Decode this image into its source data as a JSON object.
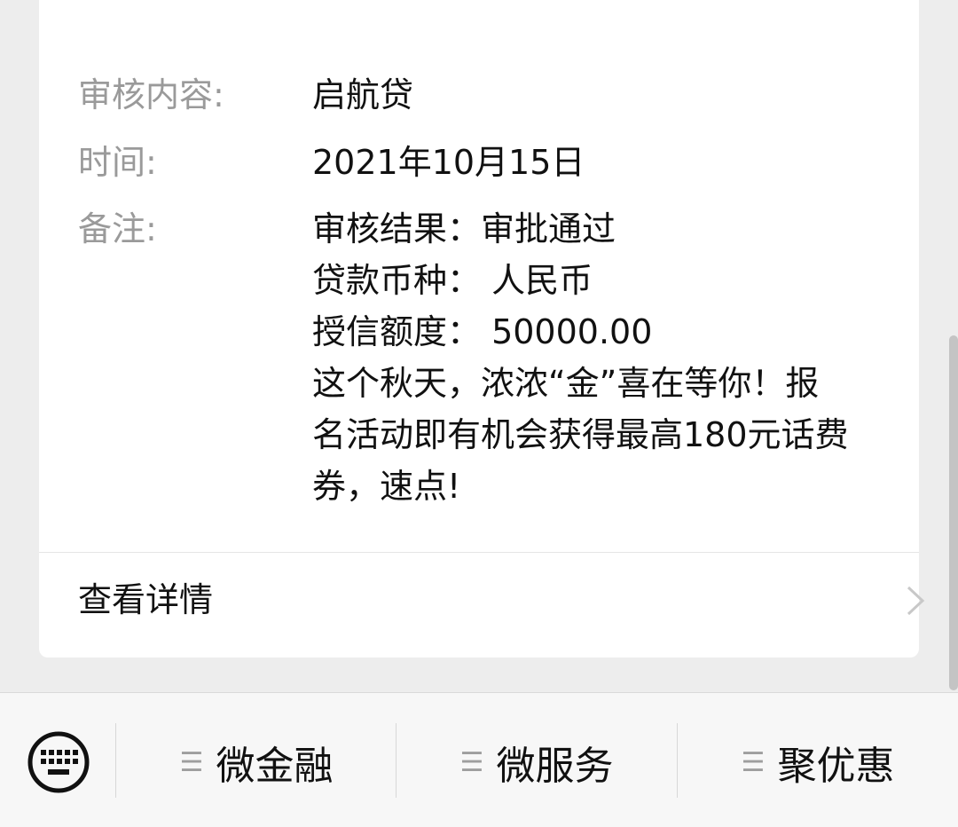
{
  "card": {
    "content_label": "审核内容:",
    "content_value": "启航贷",
    "time_label": "时间:",
    "time_value": "2021年10月15日",
    "remark_label": "备注:",
    "remark_lines": [
      "审核结果：审批通过",
      "贷款币种：  人民币",
      "授信额度：  50000.00",
      "这个秋天，浓浓“金”喜在等你！报",
      "名活动即有机会获得最高180元话费",
      "券，速点!"
    ],
    "detail_label": "查看详情"
  },
  "bottom_menu": {
    "items": [
      {
        "label": "微金融",
        "icon": "menu-lines-icon"
      },
      {
        "label": "微服务",
        "icon": "menu-lines-icon"
      },
      {
        "label": "聚优惠",
        "icon": "menu-lines-icon"
      }
    ],
    "keyboard_icon": "keyboard-icon"
  },
  "colors": {
    "background": "#ededed",
    "card": "#ffffff",
    "label_gray": "#9a9a9a",
    "text": "#111111"
  }
}
